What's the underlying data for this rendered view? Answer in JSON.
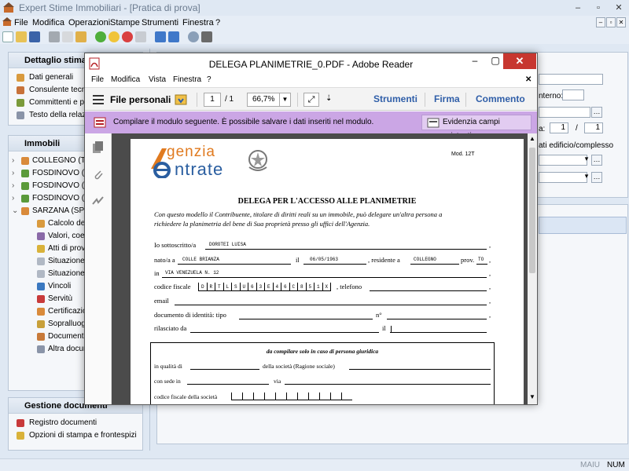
{
  "app": {
    "title": "Expert Stime Immobiliari - [Pratica di prova]",
    "menu": [
      "File",
      "Modifica",
      "Operazioni",
      "Stampe",
      "Strumenti",
      "Finestra",
      "?"
    ],
    "status_maiu": "MAIU",
    "status_num": "NUM"
  },
  "dettaglio": {
    "header": "Dettaglio stima",
    "items": [
      {
        "label": "Dati generali",
        "icon": "page-pencil-icon"
      },
      {
        "label": "Consulente tecnico",
        "icon": "person-icon"
      },
      {
        "label": "Committenti e proprietari",
        "icon": "people-icon"
      },
      {
        "label": "Testo della relazione",
        "icon": "document-icon"
      }
    ]
  },
  "immobili": {
    "header": "Immobili",
    "items": [
      {
        "label": "COLLEGNO (TO)",
        "icon": "house-icon"
      },
      {
        "label": "FOSDINOVO (MS)",
        "icon": "land-icon"
      },
      {
        "label": "FOSDINOVO (MS)",
        "icon": "land-icon"
      },
      {
        "label": "FOSDINOVO (MS)",
        "icon": "land-icon"
      },
      {
        "label": "SARZANA (SP)",
        "icon": "house-icon"
      }
    ],
    "sub_items": [
      {
        "label": "Calcolo della superficie",
        "icon": "calculator-icon"
      },
      {
        "label": "Valori, coefficienti",
        "icon": "scale-icon"
      },
      {
        "label": "Atti di provenienza",
        "icon": "pen-icon"
      },
      {
        "label": "Situazione ipotecaria",
        "icon": "document-icon"
      },
      {
        "label": "Situazione catastale",
        "icon": "document-icon"
      },
      {
        "label": "Vincoli",
        "icon": "circle-icon"
      },
      {
        "label": "Servitù",
        "icon": "chart-icon"
      },
      {
        "label": "Certificazioni",
        "icon": "certificate-icon"
      },
      {
        "label": "Sopralluoghi",
        "icon": "folder-icon"
      },
      {
        "label": "Documentazione",
        "icon": "image-icon"
      },
      {
        "label": "Altra documentazione",
        "icon": "list-icon"
      }
    ]
  },
  "gestione": {
    "header": "Gestione documenti",
    "items": [
      {
        "label": "Registro documenti",
        "icon": "register-icon"
      },
      {
        "label": "Opzioni di stampa e frontespizi",
        "icon": "options-icon"
      }
    ]
  },
  "right": {
    "interno_label": "nterno:",
    "page_label": "a:",
    "page_from": "1",
    "page_sep": "/",
    "page_to": "1",
    "edificio_label": "ati edificio/complesso"
  },
  "reader": {
    "title": "DELEGA PLANIMETRIE_0.PDF - Adobe Reader",
    "menu": [
      "File",
      "Modifica",
      "Vista",
      "Finestra",
      "?"
    ],
    "file_personali": "File personali",
    "page_current": "1",
    "page_total": "/ 1",
    "zoom": "66,7%",
    "strumenti": "Strumenti",
    "firma": "Firma",
    "commento": "Commento",
    "banner_text": "Compilare il modulo seguente. È possibile salvare i dati inseriti nel modulo.",
    "highlight_button": "Evidenzia campi esistenti",
    "colors": {
      "banner": "#cba6e5",
      "close": "#c7362f",
      "link": "#2f5ea8"
    }
  },
  "pdf": {
    "logo_top": "genzia",
    "logo_bottom": "ntrate",
    "modulo": "Mod. 12T",
    "title": "DELEGA PER L'ACCESSO ALLE PLANIMETRIE",
    "intro1": "Con questo modello il Contribuente, titolare di diritti reali su un immobile, può delegare un'altra persona a",
    "intro2": "richiedere la planimetria del bene di Sua proprietà presso gli uffici dell'Agenzia.",
    "sottoscritto_label": "Io sottoscritto/a",
    "sottoscritto_value": "DOROTEI LUISA",
    "nato_label": "nato/a a",
    "nato_value": "COLLE BRIANZA",
    "il_label": "il",
    "data_nascita": "06/05/1963",
    "residente_label": ", residente a",
    "residente_value": "COLLEGNO",
    "prov_label": "prov.",
    "prov_value": "TO",
    "in_label": "in",
    "indirizzo": "VIA VENEZUELA N. 12",
    "cf_label": "codice fiscale",
    "cf_chars": [
      "D",
      "R",
      "T",
      "L",
      "S",
      "U",
      "6",
      "3",
      "E",
      "4",
      "6",
      "C",
      "8",
      "5",
      "1",
      "X"
    ],
    "telefono_label": ", telefono",
    "email_label": "email",
    "documento_label": "documento di identità: tipo",
    "n_label": "n°",
    "rilasciato_label": "rilasciato da",
    "il2_label": "il",
    "box_title": "da compilare solo in caso di persona giuridica",
    "qualita_label": "in qualità di",
    "societa_label": "della società (Ragione sociale)",
    "sede_label": "con sede in",
    "via_label": "via",
    "cf_soc_label": "codice fiscale della società"
  }
}
